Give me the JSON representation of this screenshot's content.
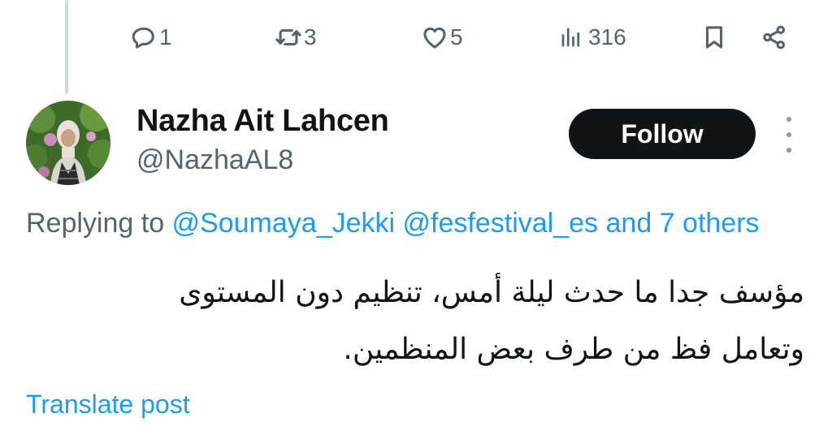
{
  "actions": {
    "reply_count": "1",
    "repost_count": "3",
    "like_count": "5",
    "views_count": "316",
    "icons": [
      "reply-icon",
      "repost-icon",
      "like-icon",
      "views-icon",
      "bookmark-icon",
      "share-icon"
    ]
  },
  "author": {
    "name": "Nazha Ait Lahcen",
    "handle": "@NazhaAL8"
  },
  "follow_button": {
    "label": "Follow"
  },
  "replying": {
    "prefix": "Replying to ",
    "mention1": "@Soumaya_Jekki",
    "mention2": "@fesfestival_es",
    "suffix": "and 7 others"
  },
  "post": {
    "line1": "مؤسف جدا ما حدث ليلة أمس، تنظيم دون المستوى",
    "line2": "وتعامل فظ من طرف بعض المنظمين."
  },
  "translate": {
    "label": "Translate post"
  },
  "colors": {
    "accent": "#1d9bf0",
    "text": "#0f1419",
    "muted": "#536471",
    "button_bg": "#0f1419"
  }
}
